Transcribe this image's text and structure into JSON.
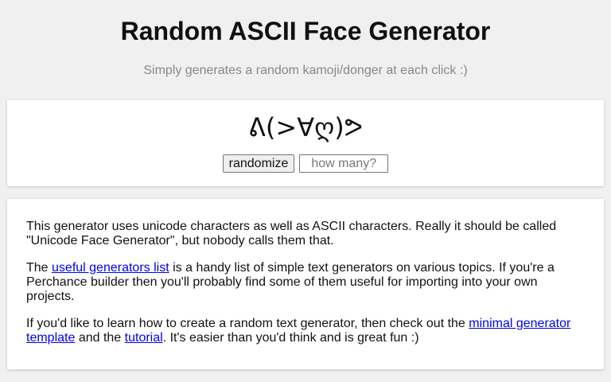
{
  "header": {
    "title": "Random ASCII Face Generator",
    "subtitle": "Simply generates a random kamoji/donger at each click :)"
  },
  "generator": {
    "face": "ᕕ(>∀ღ)ᕗ",
    "randomize_label": "randomize",
    "count_placeholder": "how many?"
  },
  "info": {
    "p1": "This generator uses unicode characters as well as ASCII characters. Really it should be called \"Unicode Face Generator\", but nobody calls them that.",
    "p2_before": "The ",
    "p2_link": "useful generators list",
    "p2_after": " is a handy list of simple text generators on various topics. If you're a Perchance builder then you'll probably find some of them useful for importing into your own projects.",
    "p3_before": "If you'd like to learn how to create a random text generator, then check out the ",
    "p3_link1": "minimal generator template",
    "p3_middle": " and the ",
    "p3_link2": "tutorial",
    "p3_after": ". It's easier than you'd think and is great fun :)"
  },
  "colors": {
    "background": "#f0f0f0",
    "link": "#0000ee",
    "subtitle": "#888888"
  }
}
